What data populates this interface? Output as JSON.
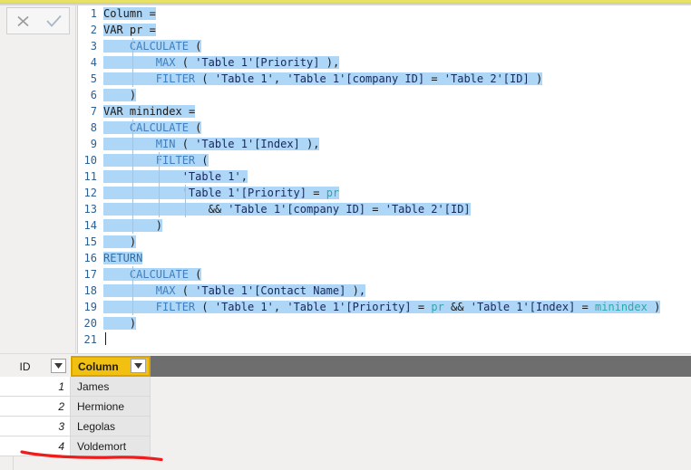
{
  "window": {
    "accent_color": "#e8e264",
    "editor_background": "#ffffff",
    "selection_color": "#aed6f7"
  },
  "formula_bar": {
    "cancel_label": "✕",
    "cancel_name": "Cancel",
    "commit_label": "✓",
    "commit_name": "Commit"
  },
  "editor": {
    "language": "DAX",
    "total_lines": 21,
    "caret_line": 21,
    "lines": [
      {
        "n": "1",
        "text": "Column ="
      },
      {
        "n": "2",
        "text": "VAR pr ="
      },
      {
        "n": "3",
        "text": "    CALCULATE ("
      },
      {
        "n": "4",
        "text": "        MAX ( 'Table 1'[Priority] ),"
      },
      {
        "n": "5",
        "text": "        FILTER ( 'Table 1', 'Table 1'[company ID] = 'Table 2'[ID] )"
      },
      {
        "n": "6",
        "text": "    )"
      },
      {
        "n": "7",
        "text": "VAR minindex ="
      },
      {
        "n": "8",
        "text": "    CALCULATE ("
      },
      {
        "n": "9",
        "text": "        MIN ( 'Table 1'[Index] ),"
      },
      {
        "n": "10",
        "text": "        FILTER ("
      },
      {
        "n": "11",
        "text": "            'Table 1',"
      },
      {
        "n": "12",
        "text": "            'Table 1'[Priority] = pr"
      },
      {
        "n": "13",
        "text": "                && 'Table 1'[company ID] = 'Table 2'[ID]"
      },
      {
        "n": "14",
        "text": "        )"
      },
      {
        "n": "15",
        "text": "    )"
      },
      {
        "n": "16",
        "text": "RETURN"
      },
      {
        "n": "17",
        "text": "    CALCULATE ("
      },
      {
        "n": "18",
        "text": "        MAX ( 'Table 1'[Contact Name] ),"
      },
      {
        "n": "19",
        "text": "        FILTER ( 'Table 1', 'Table 1'[Priority] = pr && 'Table 1'[Index] = minindex )"
      },
      {
        "n": "20",
        "text": "    )"
      },
      {
        "n": "21",
        "text": ""
      }
    ]
  },
  "grid": {
    "columns": [
      {
        "key": "id",
        "label": "ID",
        "selected": false,
        "filter_icon": "chevron-down-icon"
      },
      {
        "key": "column",
        "label": "Column",
        "selected": true,
        "filter_icon": "chevron-down-icon"
      }
    ],
    "rows": [
      {
        "id": "1",
        "column": "James"
      },
      {
        "id": "2",
        "column": "Hermione"
      },
      {
        "id": "3",
        "column": "Legolas"
      },
      {
        "id": "4",
        "column": "Voldemort"
      }
    ]
  },
  "annotation": {
    "type": "freehand-underline",
    "color": "#ef1c1c"
  }
}
